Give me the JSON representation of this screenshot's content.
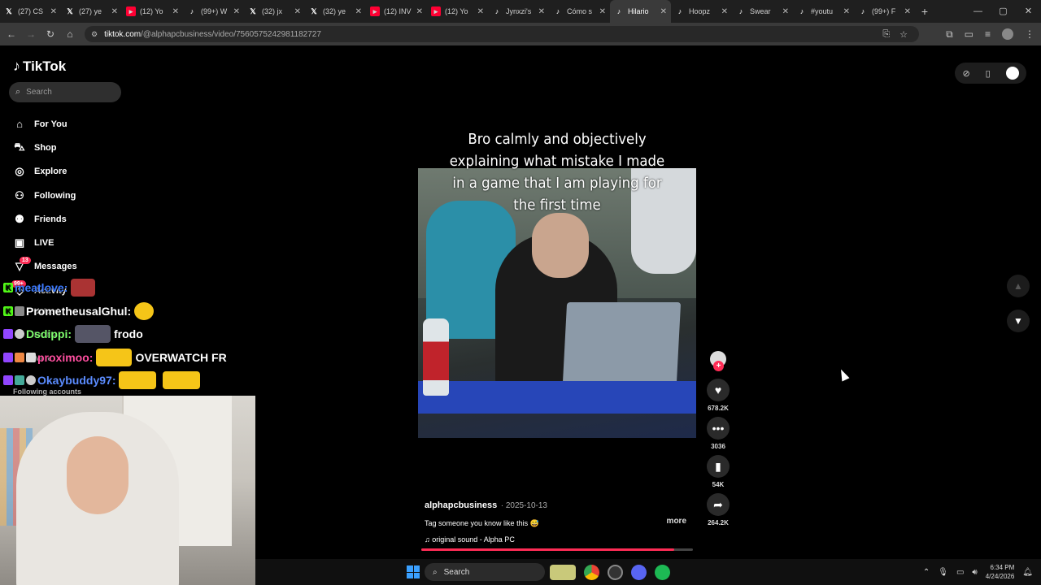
{
  "browser": {
    "tabs": [
      {
        "label": "(27) CS",
        "kind": "x"
      },
      {
        "label": "(27) ye",
        "kind": "x"
      },
      {
        "label": "(12) Yo",
        "kind": "yt"
      },
      {
        "label": "(99+) W",
        "kind": "tt"
      },
      {
        "label": "(32) jx",
        "kind": "x"
      },
      {
        "label": "(32) ye",
        "kind": "x"
      },
      {
        "label": "(12) INV",
        "kind": "yt"
      },
      {
        "label": "(12) Yo",
        "kind": "yt"
      },
      {
        "label": "Jynxzi's",
        "kind": "tt"
      },
      {
        "label": "Cómo s",
        "kind": "tt"
      },
      {
        "label": "Hilario",
        "kind": "tt",
        "active": true
      },
      {
        "label": "Hoopz",
        "kind": "tt"
      },
      {
        "label": "Swear",
        "kind": "tt"
      },
      {
        "label": "#youtu",
        "kind": "tt"
      },
      {
        "label": "(99+) F",
        "kind": "tt"
      }
    ],
    "url_host": "tiktok.com",
    "url_path": "/@alphapcbusiness/video/7560575242981182727"
  },
  "sidebar": {
    "logo": "TikTok",
    "search_placeholder": "Search",
    "items": [
      {
        "label": "For You",
        "icon": "home-icon"
      },
      {
        "label": "Shop",
        "icon": "shop-icon"
      },
      {
        "label": "Explore",
        "icon": "compass-icon"
      },
      {
        "label": "Following",
        "icon": "following-icon"
      },
      {
        "label": "Friends",
        "icon": "friends-icon"
      },
      {
        "label": "LIVE",
        "icon": "live-icon"
      },
      {
        "label": "Messages",
        "icon": "messages-icon",
        "badge": "13"
      },
      {
        "label": "Activity",
        "icon": "activity-icon",
        "badge": "99+"
      },
      {
        "label": "Upload",
        "icon": "upload-icon"
      },
      {
        "label": "Profile",
        "icon": "profile-icon"
      },
      {
        "label": "More",
        "icon": "more-icon"
      }
    ],
    "following_accounts": "Following accounts"
  },
  "chat": [
    {
      "user": "meatlove:",
      "color": "#3d7bff",
      "msg": ""
    },
    {
      "user": "PrometheusalGhul:",
      "color": "#ffffff",
      "msg": ""
    },
    {
      "user": "Dsdippi:",
      "color": "#7fff6e",
      "msg": "frodo"
    },
    {
      "user": "proximoo:",
      "color": "#ff4fa0",
      "msg": "OVERWATCH FR"
    },
    {
      "user": "Okaybuddy97:",
      "color": "#5b8cff",
      "msg": ""
    }
  ],
  "video": {
    "caption": "Bro calmly and objectively explaining what mistake I made in a game that I am playing for the first time",
    "author": "alphapcbusiness",
    "date": "· 2025-10-13",
    "description": "Tag someone you know like this 😅",
    "more": "more",
    "sound": "♫  original sound - Alpha PC",
    "progress": 0.93
  },
  "actions": {
    "likes": "678.2K",
    "comments": "3036",
    "saves": "54K",
    "shares": "264.2K"
  },
  "taskbar": {
    "search": "Search",
    "time": "6:34 PM",
    "date": "4/24/2026"
  }
}
